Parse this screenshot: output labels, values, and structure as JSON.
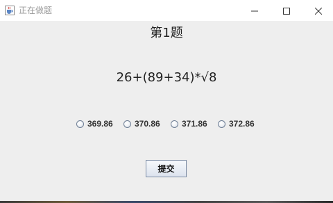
{
  "window": {
    "title": "正在做题",
    "icon": "java-cup-icon"
  },
  "controls": {
    "minimize_icon": "minimize-icon",
    "maximize_icon": "maximize-icon",
    "close_icon": "close-icon"
  },
  "quiz": {
    "question_title": "第1题",
    "expression": "26+(89+34)*√8",
    "options": [
      {
        "label": "369.86",
        "selected": false
      },
      {
        "label": "370.86",
        "selected": false
      },
      {
        "label": "371.86",
        "selected": false
      },
      {
        "label": "372.86",
        "selected": false
      }
    ],
    "submit_label": "提交"
  },
  "colors": {
    "background": "#eeeeee",
    "titlebar": "#ffffff",
    "text": "#222222"
  }
}
